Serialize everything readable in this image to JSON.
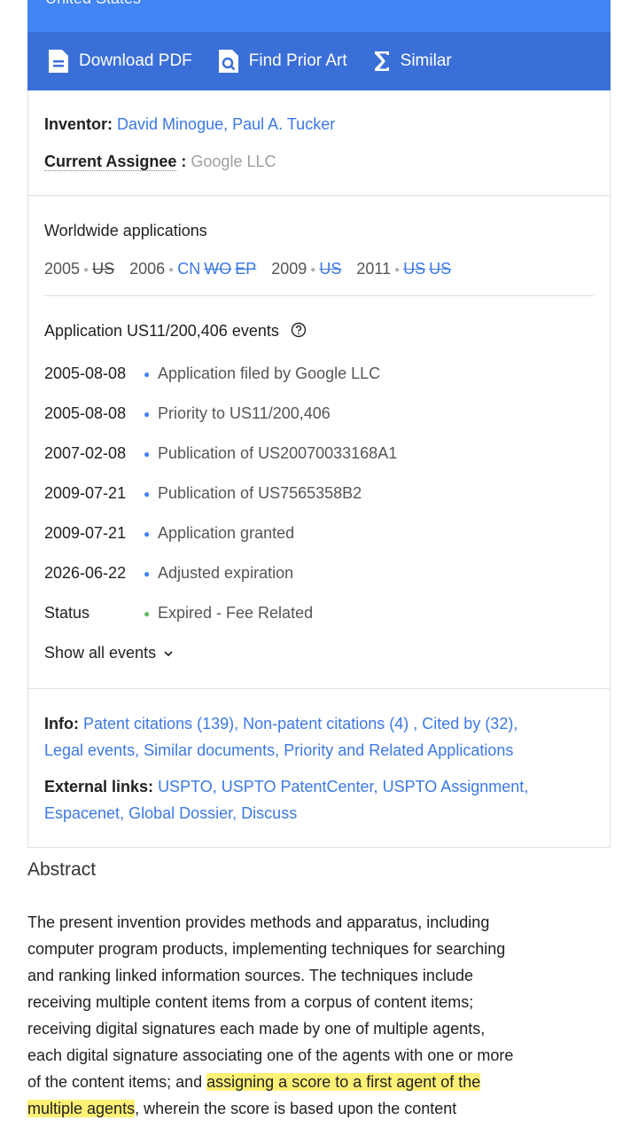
{
  "header": {
    "country": "United States"
  },
  "actions": [
    {
      "label": "Download PDF",
      "icon": "pdf-icon"
    },
    {
      "label": "Find Prior Art",
      "icon": "prior-art-icon"
    },
    {
      "label": "Similar",
      "icon": "sigma-icon"
    }
  ],
  "people": {
    "inventor_label": "Inventor:",
    "inventor_1": "David Minogue",
    "inventor_sep": ",",
    "inventor_2": "Paul A. Tucker",
    "assignee_label": "Current Assignee",
    "assignee_colon": ":",
    "assignee_value": "Google LLC"
  },
  "worldwide": {
    "title": "Worldwide applications",
    "y2005": "2005",
    "c2005_1": "US",
    "y2006": "2006",
    "c2006_1": "CN",
    "c2006_2": "WO",
    "c2006_3": "EP",
    "y2009": "2009",
    "c2009_1": "US",
    "y2011": "2011",
    "c2011_1": "US",
    "c2011_2": "US"
  },
  "events": {
    "title": "Application US11/200,406 events",
    "list": [
      {
        "date": "2005-08-08",
        "text": "Application filed by Google LLC"
      },
      {
        "date": "2005-08-08",
        "text": "Priority to US11/200,406"
      },
      {
        "date": "2007-02-08",
        "text": "Publication of US20070033168A1"
      },
      {
        "date": "2009-07-21",
        "text": "Publication of US7565358B2"
      },
      {
        "date": "2009-07-21",
        "text": "Application granted"
      },
      {
        "date": "2026-06-22",
        "text": "Adjusted expiration"
      },
      {
        "date": "Status",
        "text": "Expired - Fee Related"
      }
    ],
    "show_all": "Show all events"
  },
  "info": {
    "label": "Info:",
    "l1": "Patent citations (139)",
    "l2": "Non-patent citations (4)",
    "l3": "Cited by (32)",
    "l4": "Legal events",
    "l5": "Similar documents",
    "l6": "Priority and Related Applications",
    "ext_label": "External links:",
    "e1": "USPTO",
    "e2": "USPTO PatentCenter",
    "e3": "USPTO Assignment",
    "e4": "Espacenet",
    "e5": "Global Dossier",
    "e6": "Discuss"
  },
  "abstract": {
    "title": "Abstract",
    "p1": "The present invention provides methods and apparatus, including computer program products, implementing techniques for searching and ranking linked information sources. The techniques include receiving multiple content items from a corpus of content items; receiving digital signatures each made by one of multiple agents, each digital signature associating one of the agents with one or more of the content items; and ",
    "highlight": "assigning a score to a first agent of the multiple agents",
    "p2": ", wherein the score is based upon the content"
  }
}
